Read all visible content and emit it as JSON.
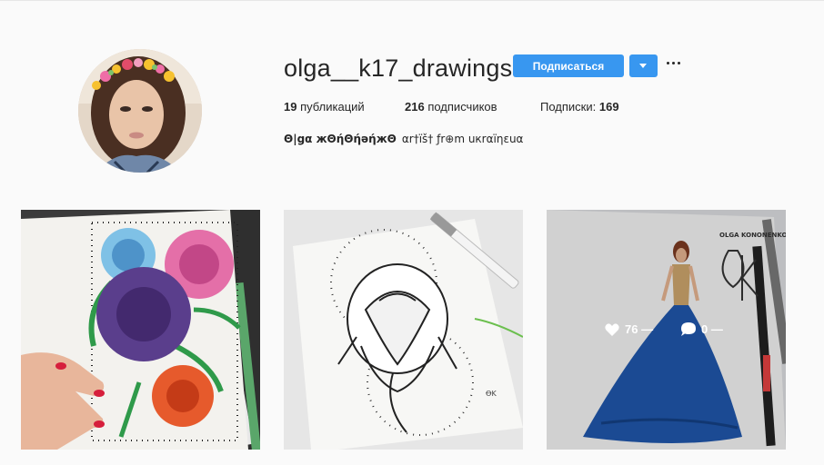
{
  "profile": {
    "username": "olga__k17_drawings",
    "follow_label": "Подписаться",
    "stats": {
      "posts_count": "19",
      "posts_label": "публикаций",
      "followers_count": "216",
      "followers_label": "подписчиков",
      "following_label": "Подписки:",
      "following_count": "169"
    },
    "full_name": "Θ|gα жΘήΘήəήжΘ",
    "bio": "αr†ïš† ƒr⊕m uкrαïηεuα",
    "avatar_icon": "profile-photo"
  },
  "posts": [
    {
      "subject": "flower-drawing"
    },
    {
      "subject": "rose-sketch"
    },
    {
      "subject": "gown-drawing",
      "likes": "76 —",
      "comments": "0 —"
    }
  ],
  "colors": {
    "accent": "#3897f0",
    "background": "#fafafa"
  }
}
